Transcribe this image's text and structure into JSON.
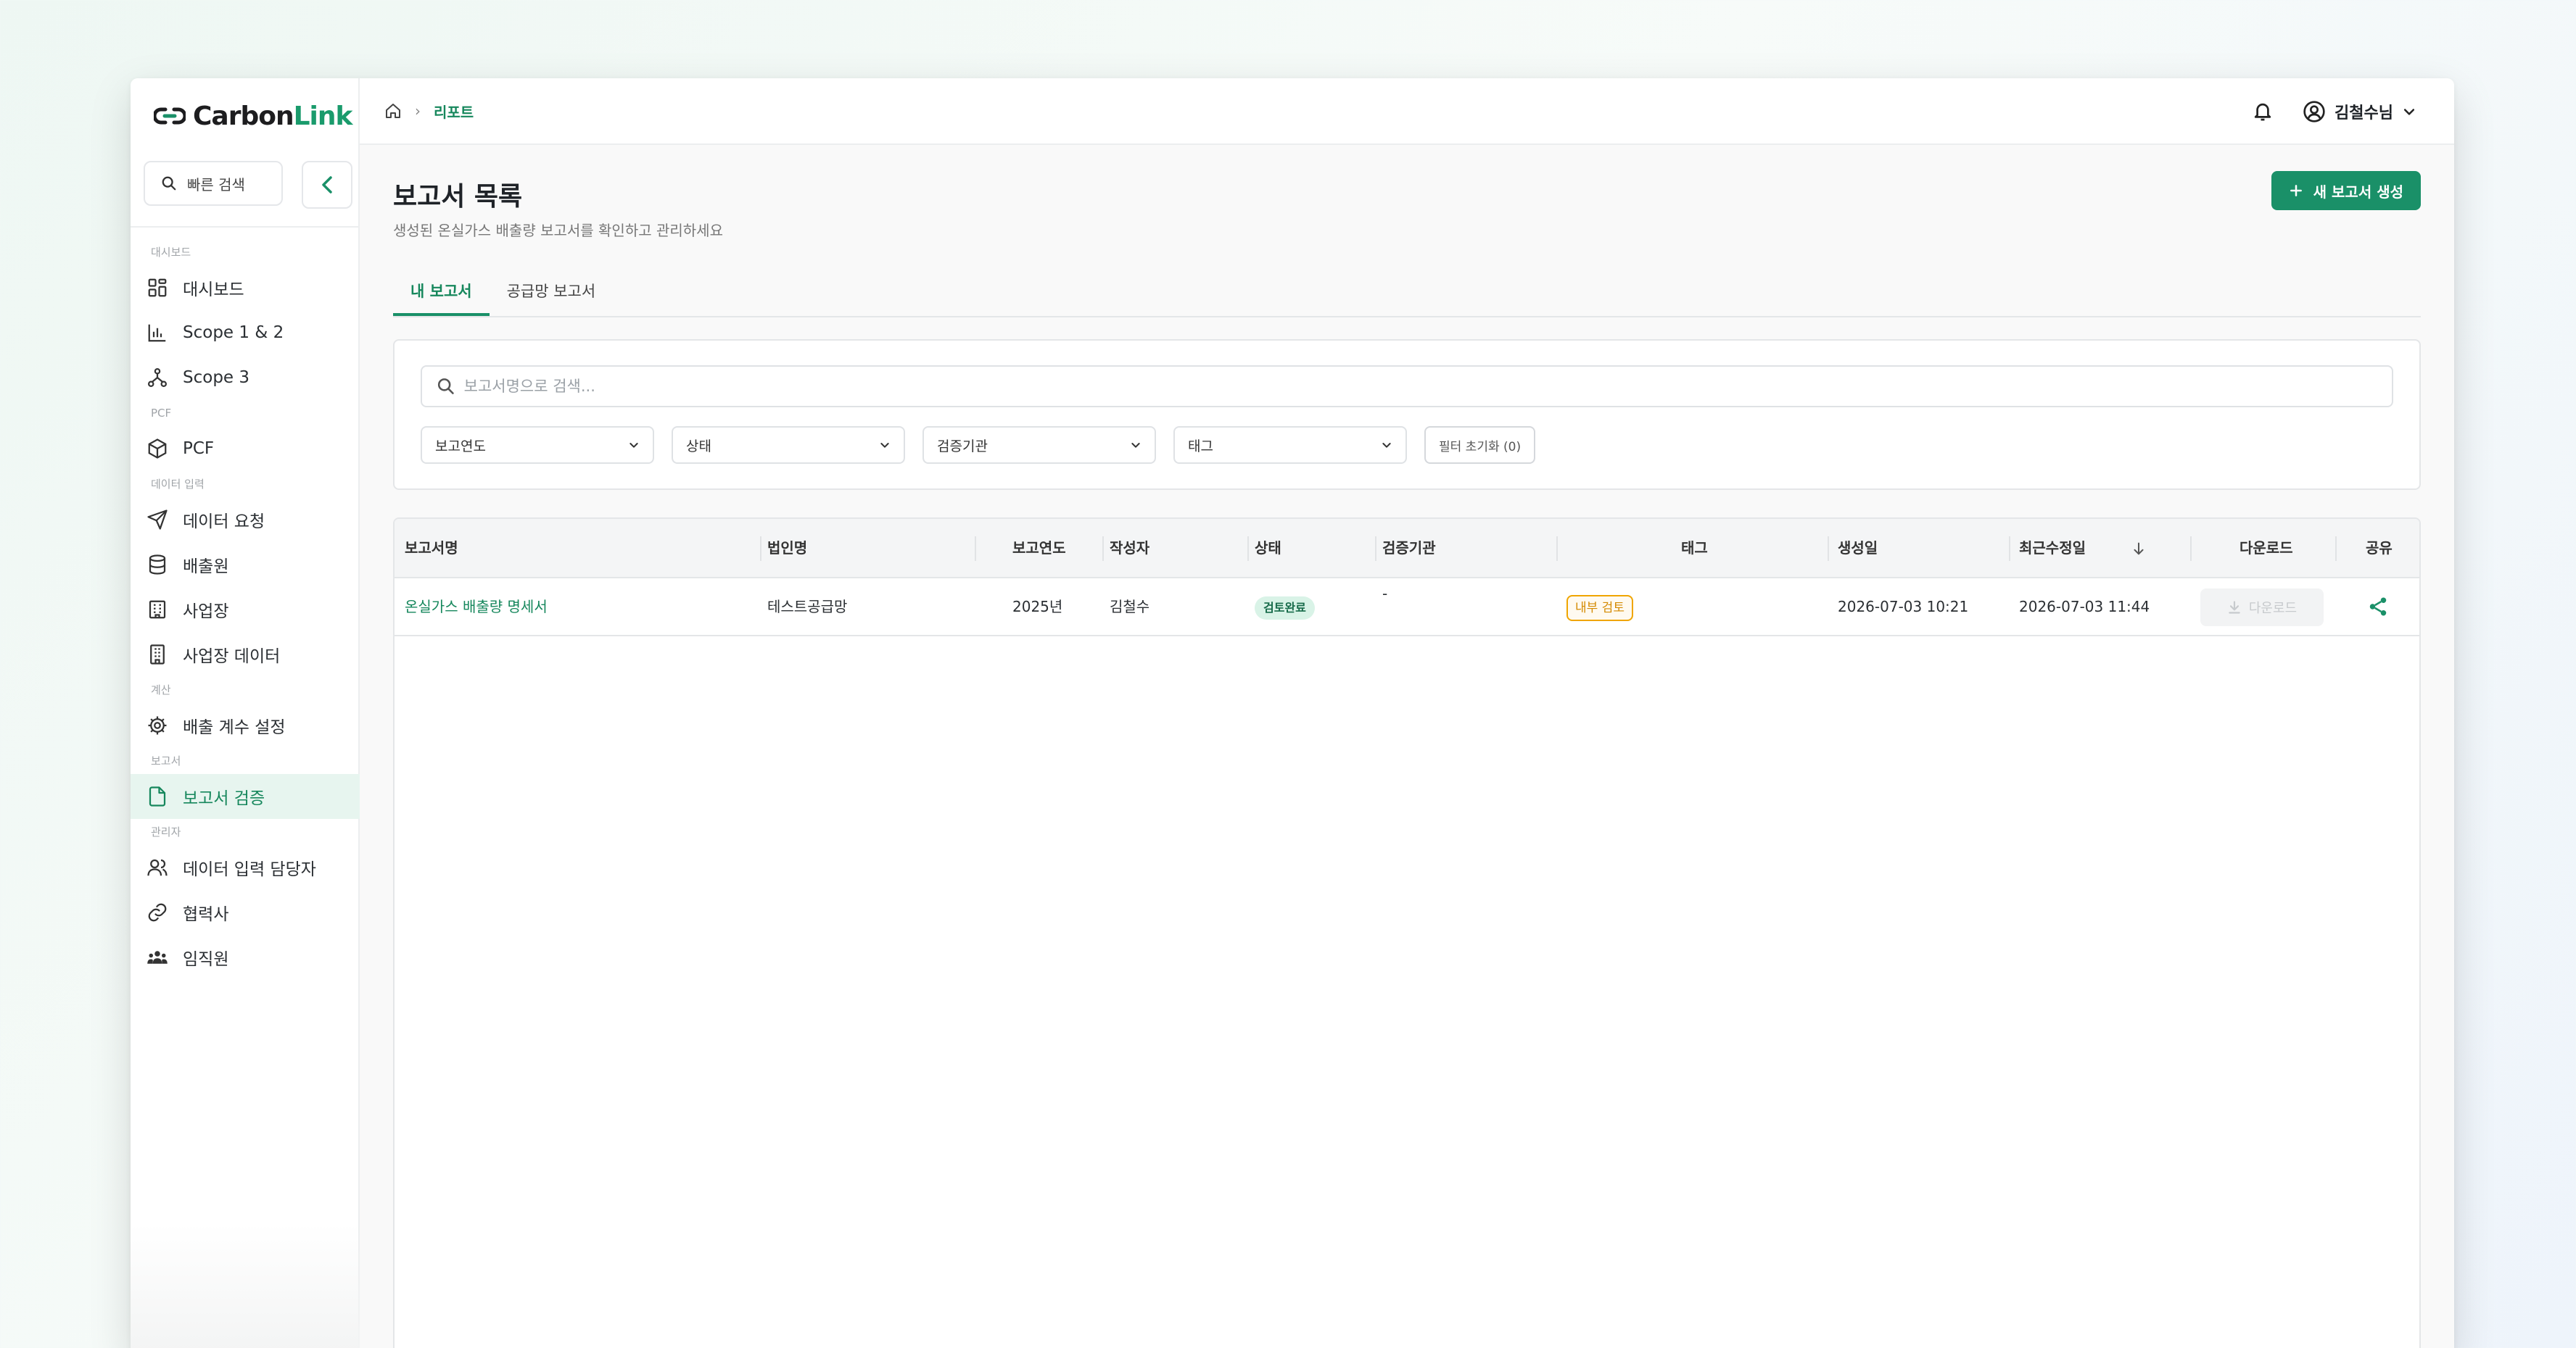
{
  "brand": {
    "name_part1": "Carbon",
    "name_part2": "Link",
    "accent": "#1a9068"
  },
  "sidebar": {
    "quick_search": "빠른 검색",
    "sections": [
      {
        "label": "대시보드",
        "items": [
          {
            "label": "대시보드",
            "icon": "grid-icon"
          },
          {
            "label": "Scope 1 & 2",
            "icon": "bar-chart-icon"
          },
          {
            "label": "Scope 3",
            "icon": "network-icon"
          }
        ]
      },
      {
        "label": "PCF",
        "items": [
          {
            "label": "PCF",
            "icon": "box-icon"
          }
        ]
      },
      {
        "label": "데이터 입력",
        "items": [
          {
            "label": "데이터 요청",
            "icon": "send-icon"
          },
          {
            "label": "배출원",
            "icon": "database-icon"
          },
          {
            "label": "사업장",
            "icon": "factory-icon"
          },
          {
            "label": "사업장 데이터",
            "icon": "building-icon"
          }
        ]
      },
      {
        "label": "계산",
        "items": [
          {
            "label": "배출 계수 설정",
            "icon": "gear-icon"
          }
        ]
      },
      {
        "label": "보고서",
        "items": [
          {
            "label": "보고서 검증",
            "icon": "file-icon",
            "active": true
          }
        ]
      },
      {
        "label": "관리자",
        "items": [
          {
            "label": "데이터 입력 담당자",
            "icon": "users-icon"
          },
          {
            "label": "협력사",
            "icon": "link-icon"
          },
          {
            "label": "임직원",
            "icon": "team-icon"
          }
        ]
      }
    ]
  },
  "header": {
    "breadcrumb_current": "리포트",
    "user_name": "김철수님"
  },
  "page": {
    "title": "보고서 목록",
    "subtitle": "생성된 온실가스 배출량 보고서를 확인하고 관리하세요",
    "new_button": "새 보고서 생성",
    "tabs": [
      {
        "label": "내 보고서",
        "active": true
      },
      {
        "label": "공급망 보고서",
        "active": false
      }
    ],
    "search_placeholder": "보고서명으로 검색...",
    "filters": [
      "보고연도",
      "상태",
      "검증기관",
      "태그"
    ],
    "reset_label": "필터 초기화 (0)"
  },
  "table": {
    "columns": [
      "보고서명",
      "법인명",
      "보고연도",
      "작성자",
      "상태",
      "검증기관",
      "태그",
      "생성일",
      "최근수정일",
      "다운로드",
      "공유"
    ],
    "rows": [
      {
        "name": "온실가스 배출량 명세서",
        "company": "테스트공급망",
        "year": "2025년",
        "author": "김철수",
        "status": "검토완료",
        "verifier": "-",
        "tag": "내부 검토",
        "created": "2026-07-03 10:21",
        "updated": "2026-07-03 11:44",
        "download": "다운로드"
      }
    ]
  }
}
